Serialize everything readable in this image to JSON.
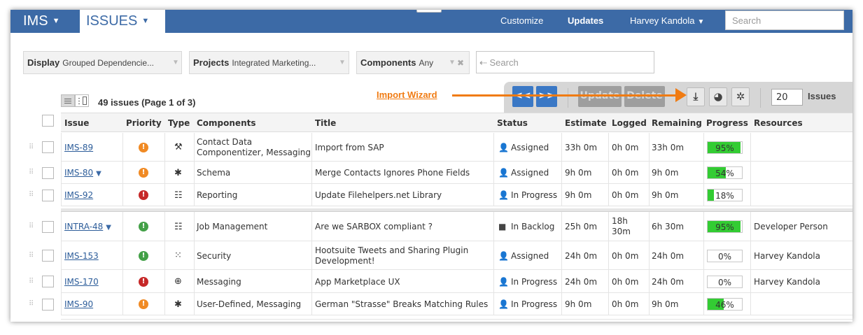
{
  "nav": {
    "app": "IMS",
    "section": "ISSUES",
    "customize": "Customize",
    "updates": "Updates",
    "user": "Harvey Kandola",
    "search_placeholder": "Search"
  },
  "filters": {
    "display_label": "Display",
    "display_value": "Grouped Dependencie...",
    "projects_label": "Projects",
    "projects_value": "Integrated Marketing...",
    "components_label": "Components",
    "components_value": "Any",
    "search_placeholder": "⇠ Search"
  },
  "summary": {
    "count_text": "49 issues (Page 1 of 3)"
  },
  "toolbar": {
    "prev": "<<",
    "next": ">>",
    "update": "Update",
    "delete": "Delete",
    "page_size": "20",
    "page_size_label": "Issues"
  },
  "annotation": {
    "text": "Import Wizard",
    "color": "#f07b12"
  },
  "columns": [
    "Issue",
    "Priority",
    "Type",
    "Components",
    "Title",
    "Status",
    "Estimate",
    "Logged",
    "Remaining",
    "Progress",
    "Resources"
  ],
  "colors": {
    "nav_bg": "#3c6aa6",
    "accent_blue": "#3a78c5",
    "progress_fill": "#33cc33",
    "priority_high": "#c62828",
    "priority_medium": "#f08a24",
    "priority_low": "#43a047"
  },
  "rows": [
    {
      "issue": "IMS-89",
      "has_dropdown": false,
      "priority": "medium",
      "priority_icon": "exclamation-orange-icon",
      "type_icon": "wrench-icon",
      "components": "Contact Data Componentizer, Messaging",
      "title": "Import from SAP",
      "status": "Assigned",
      "status_icon": "assigned-icon",
      "estimate": "33h 0m",
      "logged": "0h 0m",
      "remaining": "33h 0m",
      "progress": 95,
      "progress_text": "95%",
      "resources": ""
    },
    {
      "issue": "IMS-80",
      "has_dropdown": true,
      "priority": "medium",
      "priority_icon": "exclamation-orange-icon",
      "type_icon": "bug-icon",
      "components": "Schema",
      "title": "Merge Contacts Ignores Phone Fields",
      "status": "Assigned",
      "status_icon": "assigned-icon",
      "estimate": "9h 0m",
      "logged": "0h 0m",
      "remaining": "9h 0m",
      "progress": 54,
      "progress_text": "54%",
      "resources": ""
    },
    {
      "issue": "IMS-92",
      "has_dropdown": false,
      "priority": "high",
      "priority_icon": "exclamation-red-icon",
      "type_icon": "task-list-icon",
      "components": "Reporting",
      "title": "Update Filehelpers.net Library",
      "status": "In Progress",
      "status_icon": "in-progress-icon",
      "estimate": "9h 0m",
      "logged": "0h 0m",
      "remaining": "9h 0m",
      "progress": 18,
      "progress_text": "18%",
      "resources": ""
    },
    {
      "issue": "INTRA-48",
      "has_dropdown": true,
      "priority": "low",
      "priority_icon": "exclamation-green-icon",
      "type_icon": "task-list-icon",
      "components": "Job Management",
      "title": "Are we SARBOX compliant ?",
      "status": "In Backlog",
      "status_icon": "backlog-icon",
      "estimate": "25h 0m",
      "logged": "18h 30m",
      "remaining": "6h 30m",
      "progress": 95,
      "progress_text": "95%",
      "resources": "Developer Person"
    },
    {
      "issue": "IMS-153",
      "has_dropdown": false,
      "priority": "low",
      "priority_icon": "exclamation-green-icon",
      "type_icon": "feature-icon",
      "components": "Security",
      "title": "Hootsuite Tweets and Sharing Plugin Development!",
      "status": "Assigned",
      "status_icon": "assigned-icon",
      "estimate": "24h 0m",
      "logged": "0h 0m",
      "remaining": "24h 0m",
      "progress": 0,
      "progress_text": "0%",
      "resources": "Harvey Kandola"
    },
    {
      "issue": "IMS-170",
      "has_dropdown": false,
      "priority": "high",
      "priority_icon": "exclamation-red-icon",
      "type_icon": "plus-circle-icon",
      "components": "Messaging",
      "title": "App Marketplace UX",
      "status": "In Progress",
      "status_icon": "in-progress-icon",
      "estimate": "24h 0m",
      "logged": "0h 0m",
      "remaining": "24h 0m",
      "progress": 0,
      "progress_text": "0%",
      "resources": "Harvey Kandola"
    },
    {
      "issue": "IMS-90",
      "has_dropdown": false,
      "priority": "medium",
      "priority_icon": "exclamation-orange-icon",
      "type_icon": "bug-icon",
      "components": "User-Defined, Messaging",
      "title": "German \"Strasse\" Breaks Matching Rules",
      "status": "In Progress",
      "status_icon": "in-progress-icon",
      "estimate": "9h 0m",
      "logged": "0h 0m",
      "remaining": "9h 0m",
      "progress": 46,
      "progress_text": "46%",
      "resources": ""
    }
  ]
}
